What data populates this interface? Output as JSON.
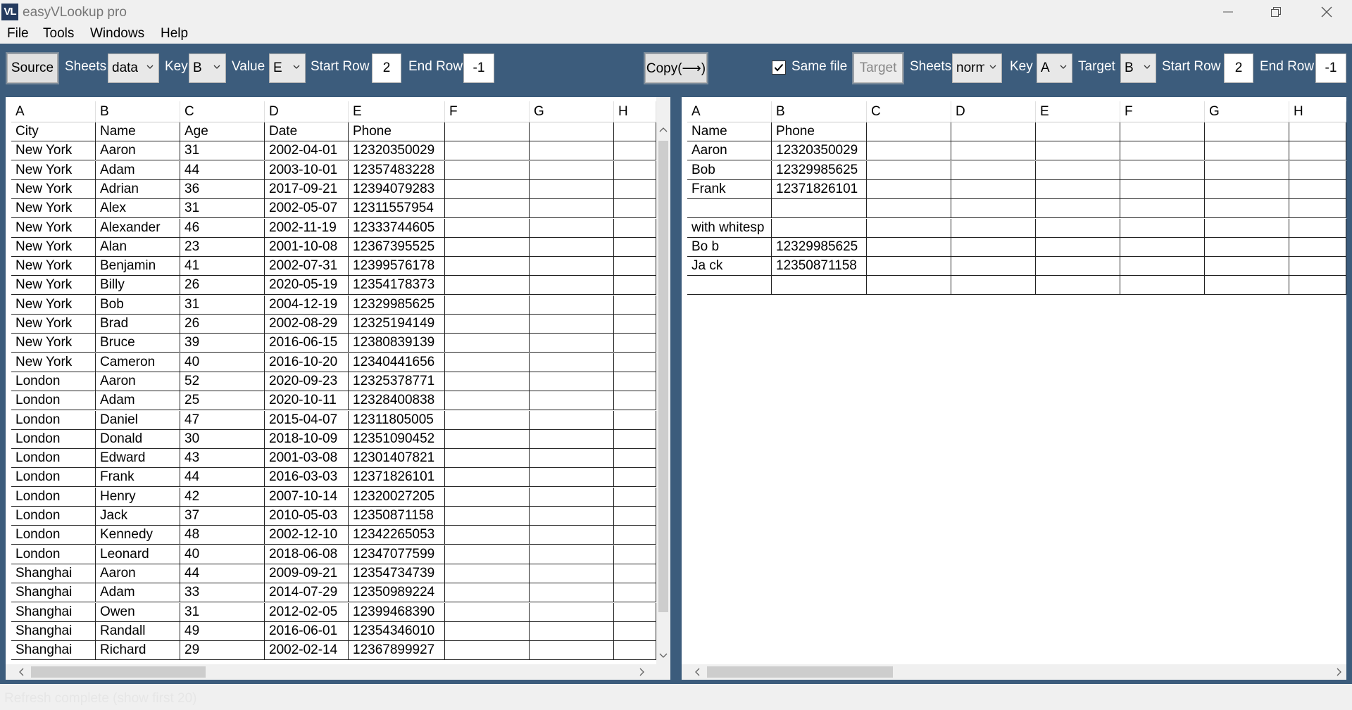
{
  "window": {
    "title": "easyVLookup pro",
    "icon_text": "VL"
  },
  "menu": [
    "File",
    "Tools",
    "Windows",
    "Help"
  ],
  "toolbar": {
    "source_label": "Source",
    "sheets_label": "Sheets",
    "source_sheet": "data",
    "key_label": "Key",
    "source_key": "B",
    "value_label": "Value",
    "source_value": "E",
    "start_row_label": "Start Row",
    "source_start_row": "2",
    "end_row_label": "End Row",
    "source_end_row": "-1",
    "copy_label": "Copy(⟶)",
    "same_file_label": "Same file",
    "same_file_checked": true,
    "target_button_label": "Target",
    "target_sheets_label": "Sheets",
    "target_sheet": "norm",
    "target_key_label": "Key",
    "target_key": "A",
    "target_label": "Target",
    "target_col": "B",
    "target_start_row_label": "Start Row",
    "target_start_row": "2",
    "target_end_row_label": "End Row",
    "target_end_row": "-1"
  },
  "left_table": {
    "columns": [
      "A",
      "B",
      "C",
      "D",
      "E",
      "F",
      "G",
      "H"
    ],
    "rows": [
      [
        "City",
        "Name",
        "Age",
        "Date",
        "Phone",
        "",
        "",
        ""
      ],
      [
        "New York",
        "Aaron",
        "31",
        "2002-04-01",
        "12320350029",
        "",
        "",
        ""
      ],
      [
        "New York",
        "Adam",
        "44",
        "2003-10-01",
        "12357483228",
        "",
        "",
        ""
      ],
      [
        "New York",
        "Adrian",
        "36",
        "2017-09-21",
        "12394079283",
        "",
        "",
        ""
      ],
      [
        "New York",
        "Alex",
        "31",
        "2002-05-07",
        "12311557954",
        "",
        "",
        ""
      ],
      [
        "New York",
        "Alexander",
        "46",
        "2002-11-19",
        "12333744605",
        "",
        "",
        ""
      ],
      [
        "New York",
        "Alan",
        "23",
        "2001-10-08",
        "12367395525",
        "",
        "",
        ""
      ],
      [
        "New York",
        "Benjamin",
        "41",
        "2002-07-31",
        "12399576178",
        "",
        "",
        ""
      ],
      [
        "New York",
        "Billy",
        "26",
        "2020-05-19",
        "12354178373",
        "",
        "",
        ""
      ],
      [
        "New York",
        "Bob",
        "31",
        "2004-12-19",
        "12329985625",
        "",
        "",
        ""
      ],
      [
        "New York",
        "Brad",
        "26",
        "2002-08-29",
        "12325194149",
        "",
        "",
        ""
      ],
      [
        "New York",
        "Bruce",
        "39",
        "2016-06-15",
        "12380839139",
        "",
        "",
        ""
      ],
      [
        "New York",
        "Cameron",
        "40",
        "2016-10-20",
        "12340441656",
        "",
        "",
        ""
      ],
      [
        "London",
        "Aaron",
        "52",
        "2020-09-23",
        "12325378771",
        "",
        "",
        ""
      ],
      [
        "London",
        "Adam",
        "25",
        "2020-10-11",
        "12328400838",
        "",
        "",
        ""
      ],
      [
        "London",
        "Daniel",
        "47",
        "2015-04-07",
        "12311805005",
        "",
        "",
        ""
      ],
      [
        "London",
        "Donald",
        "30",
        "2018-10-09",
        "12351090452",
        "",
        "",
        ""
      ],
      [
        "London",
        "Edward",
        "43",
        "2001-03-08",
        "12301407821",
        "",
        "",
        ""
      ],
      [
        "London",
        "Frank",
        "44",
        "2016-03-03",
        "12371826101",
        "",
        "",
        ""
      ],
      [
        "London",
        "Henry",
        "42",
        "2007-10-14",
        "12320027205",
        "",
        "",
        ""
      ],
      [
        "London",
        "Jack",
        "37",
        "2010-05-03",
        "12350871158",
        "",
        "",
        ""
      ],
      [
        "London",
        "Kennedy",
        "48",
        "2002-12-10",
        "12342265053",
        "",
        "",
        ""
      ],
      [
        "London",
        "Leonard",
        "40",
        "2018-06-08",
        "12347077599",
        "",
        "",
        ""
      ],
      [
        "Shanghai",
        "Aaron",
        "44",
        "2009-09-21",
        "12354734739",
        "",
        "",
        ""
      ],
      [
        "Shanghai",
        "Adam",
        "33",
        "2014-07-29",
        "12350989224",
        "",
        "",
        ""
      ],
      [
        "Shanghai",
        "Owen",
        "31",
        "2012-02-05",
        "12399468390",
        "",
        "",
        ""
      ],
      [
        "Shanghai",
        "Randall",
        "49",
        "2016-06-01",
        "12354346010",
        "",
        "",
        ""
      ],
      [
        "Shanghai",
        "Richard",
        "29",
        "2002-02-14",
        "12367899927",
        "",
        "",
        ""
      ]
    ]
  },
  "right_table": {
    "columns": [
      "A",
      "B",
      "C",
      "D",
      "E",
      "F",
      "G",
      "H"
    ],
    "rows": [
      [
        "Name",
        "Phone",
        "",
        "",
        "",
        "",
        "",
        ""
      ],
      [
        "Aaron",
        "12320350029",
        "",
        "",
        "",
        "",
        "",
        ""
      ],
      [
        "Bob",
        "12329985625",
        "",
        "",
        "",
        "",
        "",
        ""
      ],
      [
        "Frank",
        "12371826101",
        "",
        "",
        "",
        "",
        "",
        ""
      ],
      [
        "",
        "",
        "",
        "",
        "",
        "",
        "",
        ""
      ],
      [
        "with whitesp",
        "",
        "",
        "",
        "",
        "",
        "",
        ""
      ],
      [
        "Bo b",
        "12329985625",
        "",
        "",
        "",
        "",
        "",
        ""
      ],
      [
        "Ja ck",
        "12350871158",
        "",
        "",
        "",
        "",
        "",
        ""
      ],
      [
        "",
        "",
        "",
        "",
        "",
        "",
        "",
        ""
      ]
    ]
  },
  "status": {
    "text": "Refresh complete (show first 20)"
  }
}
